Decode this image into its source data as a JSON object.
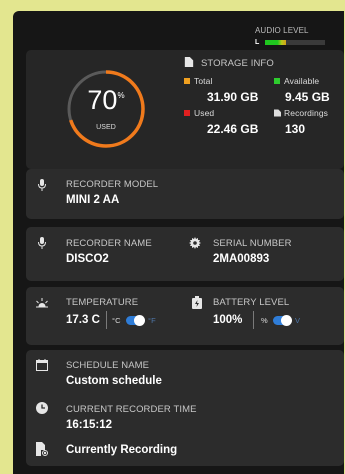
{
  "audio": {
    "label": "AUDIO LEVEL",
    "channel": "L",
    "level": 0.35
  },
  "storage": {
    "title": "STORAGE INFO",
    "used_percent_value": "70",
    "percent_sign": "%",
    "used_caption": "USED",
    "used_fraction": 0.7,
    "total_label": "Total",
    "total_value": "31.90 GB",
    "available_label": "Available",
    "available_value": "9.45 GB",
    "used_label": "Used",
    "used_value": "22.46 GB",
    "recordings_label": "Recordings",
    "recordings_value": "130",
    "colors": {
      "total": "#f0a020",
      "available": "#2ecc2e",
      "used": "#e02020",
      "recordings": "#dddddd",
      "ring": "#f07a1c"
    }
  },
  "recorder_model": {
    "label": "RECORDER MODEL",
    "value": "MINI 2 AA",
    "icon": "microphone-icon"
  },
  "recorder_name": {
    "label": "RECORDER NAME",
    "value": "DISCO2",
    "icon": "microphone-icon"
  },
  "serial_number": {
    "label": "SERIAL NUMBER",
    "value": "2MA00893",
    "icon": "gear-icon"
  },
  "temperature": {
    "label": "TEMPERATURE",
    "value": "17.3 C",
    "unit_c": "°C",
    "unit_f": "°F",
    "icon": "sunrise-icon"
  },
  "battery": {
    "label": "BATTERY LEVEL",
    "value": "100%",
    "unit_pct": "%",
    "unit_v": "V",
    "icon": "battery-icon"
  },
  "schedule": {
    "label": "SCHEDULE NAME",
    "value": "Custom schedule",
    "icon": "calendar-icon"
  },
  "recorder_time": {
    "label": "CURRENT RECORDER TIME",
    "value": "16:15:12",
    "icon": "clock-icon"
  },
  "recording_status": {
    "value": "Currently Recording",
    "icon": "recording-file-icon"
  },
  "accent": "#2f7dd8"
}
